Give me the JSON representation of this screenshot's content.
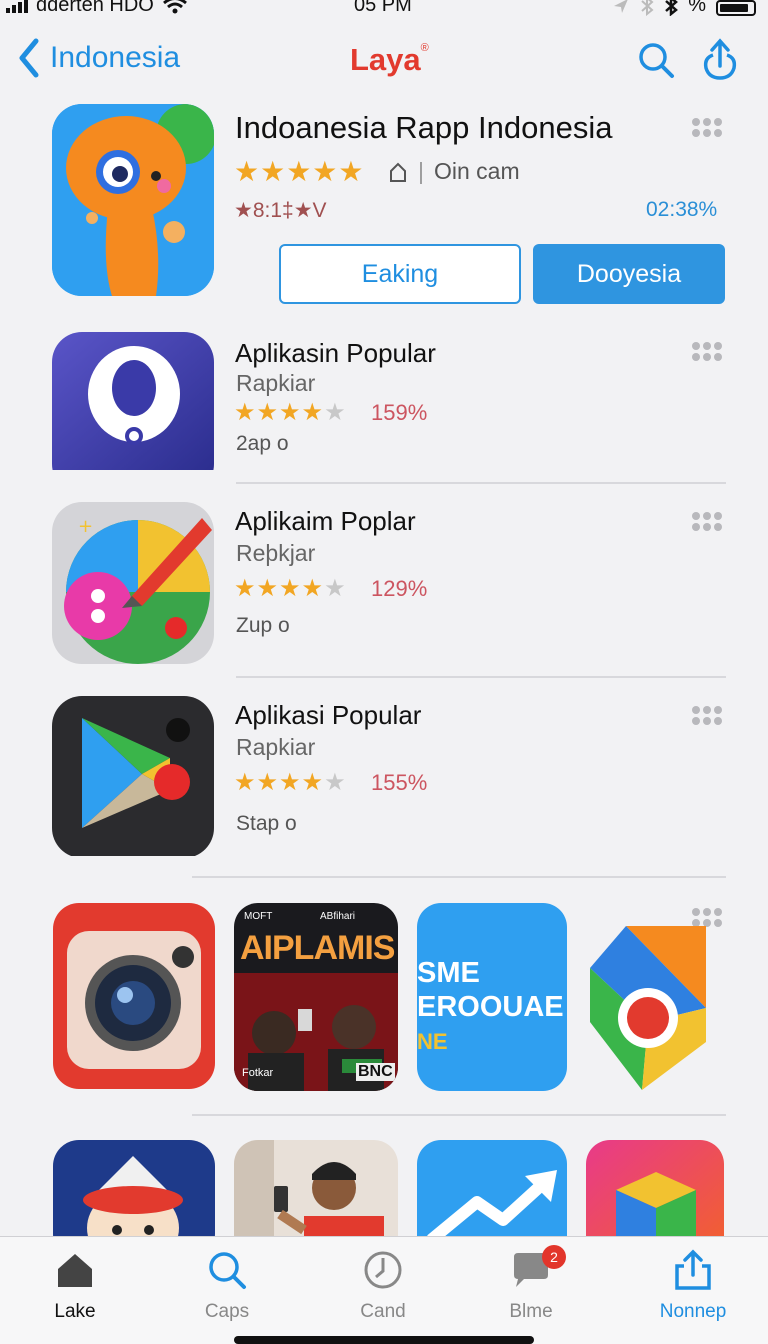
{
  "status_bar": {
    "carrier": "ddérten HDO",
    "time": "05 PM",
    "battery": "%"
  },
  "nav": {
    "back_label": "Indonesia",
    "title": "Laya",
    "title_mark": "®"
  },
  "featured": {
    "title": "Indoanesia Rapp Indonesia",
    "rating_stars": "★★★★★",
    "meta": "Oin cam",
    "code": "★8:1‡★V",
    "percent": "02:38%",
    "button_outline": "Eaking",
    "button_primary": "Dooyesia"
  },
  "list": [
    {
      "title": "Aplikasin Popular",
      "subtitle": "Rapkiar",
      "stars_on": "★★★★",
      "stars_off": "★",
      "percent": "159%",
      "size": "2ap o"
    },
    {
      "title": "Aplikaim Poplar",
      "subtitle": "Reþkjar",
      "stars_on": "★★★★",
      "stars_off": "★",
      "percent": "129%",
      "size": "Zup o"
    },
    {
      "title": "Aplikasi Popular",
      "subtitle": "Rapkiar",
      "stars_on": "★★★★",
      "stars_off": "★",
      "percent": "155%",
      "size": "Stap o"
    }
  ],
  "tiles": {
    "poster": {
      "top_left": "MOFT",
      "top_right": "ABfihari",
      "headline": "AIPLAMIS",
      "bottom_left": "Fotkar",
      "bottom_right": "BNC"
    },
    "blue_text": {
      "line1": "SME",
      "line2": "EROOUAE",
      "line3": "NE"
    }
  },
  "tabs": [
    {
      "label": "Lake",
      "icon": "home-icon",
      "active": true
    },
    {
      "label": "Caps",
      "icon": "search-icon"
    },
    {
      "label": "Cand",
      "icon": "clock-icon"
    },
    {
      "label": "Blme",
      "icon": "chat-icon",
      "badge": "2"
    },
    {
      "label": "Nonnep",
      "icon": "share-icon"
    }
  ],
  "colors": {
    "accent": "#2f95e0",
    "title_red": "#e23a2e",
    "star": "#f2a623",
    "badge": "#e2352b"
  }
}
